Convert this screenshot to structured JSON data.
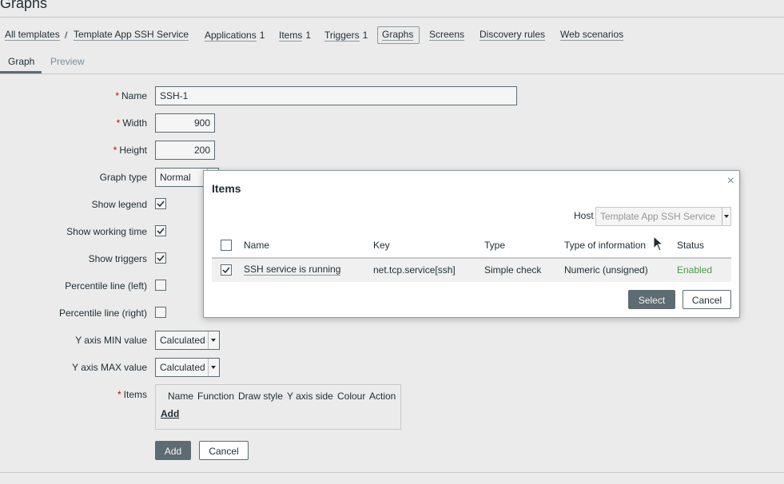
{
  "page": {
    "title": "Graphs"
  },
  "breadcrumb": {
    "all_templates": "All templates",
    "separator": "/",
    "template": "Template App SSH Service"
  },
  "nav": {
    "applications": {
      "label": "Applications",
      "count": "1"
    },
    "items": {
      "label": "Items",
      "count": "1"
    },
    "triggers": {
      "label": "Triggers",
      "count": "1"
    },
    "graphs": {
      "label": "Graphs"
    },
    "screens": {
      "label": "Screens"
    },
    "discovery": {
      "label": "Discovery rules"
    },
    "web": {
      "label": "Web scenarios"
    }
  },
  "subtabs": {
    "graph": "Graph",
    "preview": "Preview"
  },
  "form": {
    "required_mark": "*",
    "name": {
      "label": "Name",
      "value": "SSH-1"
    },
    "width": {
      "label": "Width",
      "value": "900"
    },
    "height": {
      "label": "Height",
      "value": "200"
    },
    "graph_type": {
      "label": "Graph type",
      "value": "Normal"
    },
    "show_legend": {
      "label": "Show legend",
      "checked": true
    },
    "show_working_time": {
      "label": "Show working time",
      "checked": true
    },
    "show_triggers": {
      "label": "Show triggers",
      "checked": true
    },
    "percentile_left": {
      "label": "Percentile line (left)",
      "checked": false
    },
    "percentile_right": {
      "label": "Percentile line (right)",
      "checked": false
    },
    "y_min": {
      "label": "Y axis MIN value",
      "value": "Calculated"
    },
    "y_max": {
      "label": "Y axis MAX value",
      "value": "Calculated"
    },
    "items": {
      "label": "Items",
      "columns": [
        "Name",
        "Function",
        "Draw style",
        "Y axis side",
        "Colour",
        "Action"
      ],
      "add_link": "Add"
    },
    "add_button": "Add",
    "cancel_button": "Cancel"
  },
  "modal": {
    "title": "Items",
    "close": "×",
    "host_label": "Host",
    "host_value": "Template App SSH Service",
    "columns": {
      "name": "Name",
      "key": "Key",
      "type": "Type",
      "type_of_info": "Type of information",
      "status": "Status"
    },
    "rows": [
      {
        "checked": true,
        "name": "SSH service is running",
        "key": "net.tcp.service[ssh]",
        "type": "Simple check",
        "type_of_info": "Numeric (unsigned)",
        "status": "Enabled"
      }
    ],
    "select_button": "Select",
    "cancel_button": "Cancel"
  },
  "colors": {
    "background": "#ebebeb",
    "primary_button": "#5d6b72",
    "required": "#d40000",
    "status_enabled": "#429e47"
  }
}
